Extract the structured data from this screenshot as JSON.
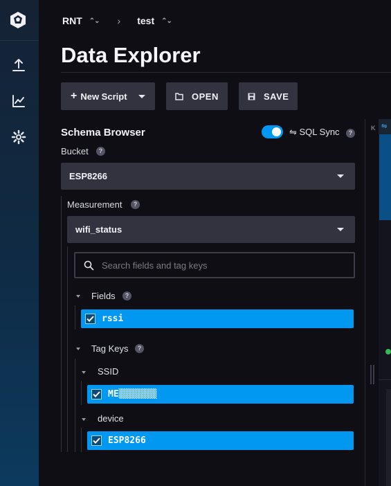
{
  "breadcrumb": {
    "org": "RNT",
    "bucket": "test"
  },
  "page": {
    "title": "Data Explorer"
  },
  "toolbar": {
    "new_script": "New Script",
    "open": "OPEN",
    "save": "SAVE"
  },
  "schema": {
    "title": "Schema Browser",
    "sql_sync_label": "⇋ SQL Sync",
    "sql_sync_enabled": true,
    "bucket_label": "Bucket",
    "bucket_value": "ESP8266",
    "measurement_label": "Measurement",
    "measurement_value": "wifi_status",
    "search_placeholder": "Search fields and tag keys",
    "fields_label": "Fields",
    "fields": [
      {
        "name": "rssi",
        "checked": true
      }
    ],
    "tag_keys_label": "Tag Keys",
    "tag_keys": [
      {
        "name": "SSID",
        "values": [
          {
            "name": "ME▒▒▒▒▒▒▒",
            "checked": true
          }
        ]
      },
      {
        "name": "device",
        "values": [
          {
            "name": "ESP8266",
            "checked": true
          }
        ]
      }
    ]
  },
  "right_panel": {
    "collapse_label": "K",
    "icon": "⇋"
  },
  "help_icon": "?",
  "colors": {
    "accent": "#0098f0",
    "surface": "#33333f",
    "background": "#0e0e14",
    "sidebar": "#0f2b45"
  }
}
